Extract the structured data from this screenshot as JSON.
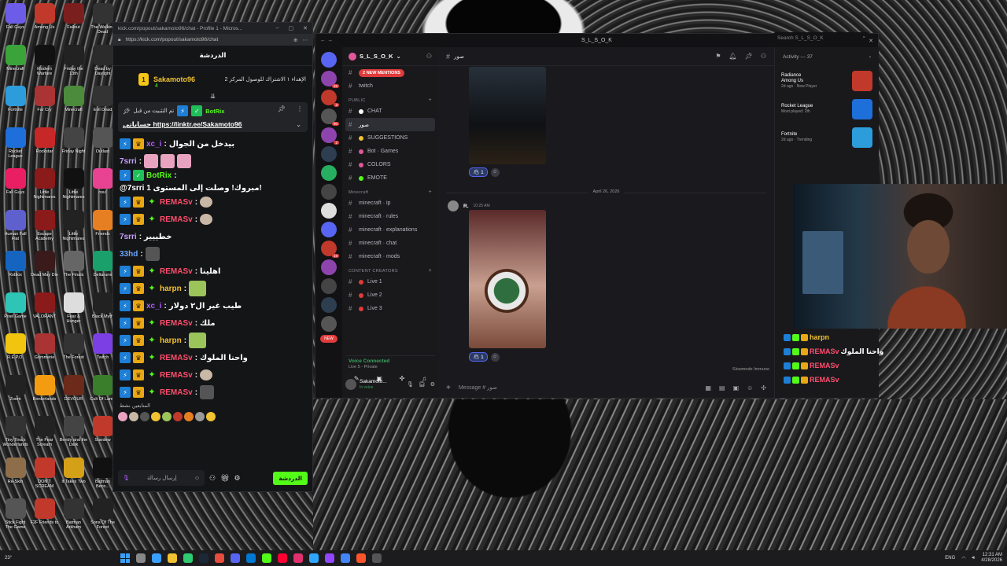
{
  "desktop": {
    "icons": [
      {
        "label": "Fall Guys",
        "icon": "fall-guys-icon",
        "color": "#6c5ce7"
      },
      {
        "label": "Among Us",
        "icon": "among-us-icon",
        "color": "#c0392b"
      },
      {
        "label": "Fallout",
        "icon": "fallout-icon",
        "color": "#7b1e1e"
      },
      {
        "label": "The Walking Dead",
        "icon": "walking-dead-icon",
        "color": "#333"
      },
      {
        "label": "Minecraft",
        "icon": "minecraft-icon",
        "color": "#3aa33a"
      },
      {
        "label": "Modern Warfare",
        "icon": "mw-icon",
        "color": "#111"
      },
      {
        "label": "Friday the 13th",
        "icon": "friday-icon",
        "color": "#222"
      },
      {
        "label": "Dead by Daylight",
        "icon": "dbd-icon",
        "color": "#2b2b2b"
      },
      {
        "label": "Fortnite",
        "icon": "fortnite-icon",
        "color": "#2d9cdb"
      },
      {
        "label": "Far Cry",
        "icon": "farcry-icon",
        "color": "#a33"
      },
      {
        "label": "Minecraft",
        "icon": "minecraft2-icon",
        "color": "#4b8b3b"
      },
      {
        "label": "Evil Dead",
        "icon": "evil-dead-icon",
        "color": "#333"
      },
      {
        "label": "Rocket League",
        "icon": "rocket-league-icon",
        "color": "#1e6fd9"
      },
      {
        "label": "Rockstar",
        "icon": "rockstar-icon",
        "color": "#c62828"
      },
      {
        "label": "Friday Night",
        "icon": "fnf-icon",
        "color": "#444"
      },
      {
        "label": "Outlast",
        "icon": "outlast-icon",
        "color": "#555"
      },
      {
        "label": "Fall Guys",
        "icon": "fallguys2-icon",
        "color": "#e91e63"
      },
      {
        "label": "Little Nightmares",
        "icon": "little-nightmares-icon",
        "color": "#8b1a1a"
      },
      {
        "label": "Little Nightmares",
        "icon": "little-nightmares2-icon",
        "color": "#111"
      },
      {
        "label": "osu!",
        "icon": "osu-icon",
        "color": "#e84393"
      },
      {
        "label": "Human Fall Flat",
        "icon": "human-icon",
        "color": "#5e60ce"
      },
      {
        "label": "Escape Academy",
        "icon": "escape-icon",
        "color": "#8b1a1a"
      },
      {
        "label": "Little Nightmares",
        "icon": "ln3-icon",
        "color": "#222"
      },
      {
        "label": "Friends",
        "icon": "friends-icon",
        "color": "#e67e22"
      },
      {
        "label": "Roblox",
        "icon": "roblox-icon",
        "color": "#1565c0"
      },
      {
        "label": "Dead May Die",
        "icon": "dead-may-die-icon",
        "color": "#3a1a1a"
      },
      {
        "label": "The Finals",
        "icon": "finals-icon",
        "color": "#666"
      },
      {
        "label": "Deltarune",
        "icon": "deltarune-icon",
        "color": "#1aa06b"
      },
      {
        "label": "Pixel Game",
        "icon": "pixel-icon",
        "color": "#2ec4b6"
      },
      {
        "label": "VALORANT",
        "icon": "valorant-icon",
        "color": "#8b1a1a"
      },
      {
        "label": "Fear & Hunger",
        "icon": "fear-icon",
        "color": "#ddd"
      },
      {
        "label": "Black Myth",
        "icon": "black-myth-icon",
        "color": "#222"
      },
      {
        "label": "R.E.P.O.",
        "icon": "repo-icon",
        "color": "#f1c40f"
      },
      {
        "label": "Grimmerie",
        "icon": "grim-icon",
        "color": "#a33"
      },
      {
        "label": "The Forest",
        "icon": "forest-icon",
        "color": "#333"
      },
      {
        "label": "Twitch",
        "icon": "twitch-icon",
        "color": "#7b3fe4"
      },
      {
        "label": "Zoom",
        "icon": "zoom-icon",
        "color": "#222"
      },
      {
        "label": "Borderlands",
        "icon": "borderlands-icon",
        "color": "#f39c12"
      },
      {
        "label": "DEVOUR",
        "icon": "devour-icon",
        "color": "#6b2a1a"
      },
      {
        "label": "Cult Of Lamb",
        "icon": "cult-icon",
        "color": "#3a7d2a"
      },
      {
        "label": "Tiny Tina's Wonderlands",
        "icon": "tiny-tina-icon",
        "color": "#333"
      },
      {
        "label": "The Fear Scream",
        "icon": "fear-scream-icon",
        "color": "#222"
      },
      {
        "label": "Bendy and the Dark",
        "icon": "bendy-icon",
        "color": "#444"
      },
      {
        "label": "Stardew",
        "icon": "stardew-icon",
        "color": "#c0392b"
      },
      {
        "label": "Re-Skin",
        "icon": "reskin-icon",
        "color": "#8e6e4a"
      },
      {
        "label": "DON'T SCREAM",
        "icon": "dont-scream-icon",
        "color": "#c0392b"
      },
      {
        "label": "It Takes Two",
        "icon": "it-takes-two-icon",
        "color": "#d4a017"
      },
      {
        "label": "Batman Beco...",
        "icon": "batman-icon",
        "color": "#111"
      },
      {
        "label": "Stick Fight The Game",
        "icon": "stick-fight-icon",
        "color": "#555"
      },
      {
        "label": "F2F Friends to",
        "icon": "f2f-icon",
        "color": "#c0392b"
      },
      {
        "label": "Batman Arkham",
        "icon": "batman2-icon",
        "color": "#333"
      },
      {
        "label": "Sons Of The Forest",
        "icon": "sons-icon",
        "color": "#222"
      }
    ]
  },
  "kick": {
    "window_title": "kick.com/popout/sakamoto96/chat - Profile 1 - Micros...",
    "url": "https://kick.com/popout/sakamoto96/chat",
    "chat_header": "الدردشة",
    "goal": {
      "name": "Sakamoto96",
      "rank": "1",
      "count": "4",
      "text": "الإهداء ١ الاشتراك للوصول المركز 2"
    },
    "pinned": {
      "by": "تم التثبيت من قبل",
      "name": "BotRix",
      "prefix": "حساباتي",
      "link": "https://linktr.ee/Sakamoto96"
    },
    "messages": [
      {
        "user": "xc_i",
        "color": "#b05cff",
        "text": "بيدخل من الجوال",
        "badges": [
          "b-blue",
          "b-gold"
        ]
      },
      {
        "user": "7srri",
        "color": "#c7a0ff",
        "text": "",
        "emotes": [
          "pink",
          "pink",
          "pink"
        ],
        "badges": []
      },
      {
        "user": "BotRix",
        "color": "#53fc18",
        "text": "@7srri مبروك! وصلت إلى المستوى 1!",
        "badges": [
          "b-blue",
          "b-green"
        ]
      },
      {
        "user": "REMASv",
        "color": "#ff4d6d",
        "text": "",
        "emotes": [
          "cat"
        ],
        "badges": [
          "b-blue",
          "b-gold",
          "b-spark"
        ]
      },
      {
        "user": "REMASv",
        "color": "#ff4d6d",
        "text": "",
        "emotes": [
          "cat"
        ],
        "badges": [
          "b-blue",
          "b-gold",
          "b-spark"
        ]
      },
      {
        "user": "7srri",
        "color": "#c7a0ff",
        "text": "خطييير",
        "badges": []
      },
      {
        "user": "33hd",
        "color": "#6aa7ff",
        "text": "",
        "emotes": [
          "dark"
        ],
        "badges": []
      },
      {
        "user": "REMASv",
        "color": "#ff4d6d",
        "text": "اهلينا",
        "badges": [
          "b-blue",
          "b-gold",
          "b-spark"
        ]
      },
      {
        "user": "harpn",
        "color": "#f1c232",
        "text": "",
        "emotes": [
          "green"
        ],
        "badges": [
          "b-blue",
          "b-gold",
          "b-spark"
        ]
      },
      {
        "user": "xc_i",
        "color": "#b05cff",
        "text": "طيب غير ال٢ دولار",
        "badges": [
          "b-blue",
          "b-gold"
        ]
      },
      {
        "user": "REMASv",
        "color": "#ff4d6d",
        "text": "ملك",
        "badges": [
          "b-blue",
          "b-gold",
          "b-spark"
        ]
      },
      {
        "user": "harpn",
        "color": "#f1c232",
        "text": "",
        "emotes": [
          "green"
        ],
        "badges": [
          "b-blue",
          "b-gold",
          "b-spark"
        ]
      },
      {
        "user": "REMASv",
        "color": "#ff4d6d",
        "text": "واحنا الملوك",
        "badges": [
          "b-blue",
          "b-gold",
          "b-spark"
        ]
      },
      {
        "user": "REMASv",
        "color": "#ff4d6d",
        "text": "",
        "emotes": [
          "cat"
        ],
        "badges": [
          "b-blue",
          "b-gold",
          "b-spark"
        ]
      },
      {
        "user": "REMASv",
        "color": "#ff4d6d",
        "text": "",
        "emotes": [
          "dark"
        ],
        "badges": [
          "b-blue",
          "b-gold",
          "b-spark"
        ]
      }
    ],
    "active_label": "المتابعين نشط",
    "input_placeholder": "إرسال رسالة",
    "send_label": "الدردشة"
  },
  "discord": {
    "window_title": "S_L_S_O_K",
    "guild_name": "S_L_S_O_K",
    "top_channels": [
      {
        "name": "2 NEW MENTIONS",
        "type": "mentions"
      },
      {
        "name": "twitch",
        "type": "text"
      }
    ],
    "categories": [
      {
        "name": "PUBLIC",
        "channels": [
          {
            "name": "CHAT",
            "dot": "#ffffff"
          },
          {
            "name": "صور",
            "active": true
          },
          {
            "name": "SUGGESTIONS",
            "dot": "#f1c232"
          },
          {
            "name": "Bot · Games",
            "dot": "#e0589b"
          },
          {
            "name": "COLORS",
            "dot": "#e0589b"
          },
          {
            "name": "EMOTE",
            "dot": "#53fc18"
          }
        ]
      },
      {
        "name": "Minecraft",
        "channels": [
          {
            "name": "minecraft · ip"
          },
          {
            "name": "minecraft · rules"
          },
          {
            "name": "minecraft · explanations"
          },
          {
            "name": "minecraft · chat"
          },
          {
            "name": "minecraft · mods"
          }
        ]
      },
      {
        "name": "CONTENT CREATORS",
        "channels": [
          {
            "name": "Live 1",
            "dot": "#e03b3b"
          },
          {
            "name": "Live 2",
            "dot": "#e03b3b"
          },
          {
            "name": "Live 3",
            "dot": "#e03b3b"
          }
        ]
      }
    ],
    "voice": {
      "status": "Voice Connected",
      "channel": "Live 5 - Private"
    },
    "user": {
      "name": "Sakamoto...",
      "status": "In voice"
    },
    "current_channel": "صور",
    "search_placeholder": "Search S_L_S_O_K",
    "date_divider": "April 26, 2026",
    "message_author": "R.",
    "message_time": "10:25 AM",
    "reaction_count": "1",
    "slowmode": "Slowmode Immune",
    "composer_placeholder": "Message # صور",
    "activity": {
      "header": "Activity — 37",
      "items": [
        {
          "user": "Radiance",
          "game": "Among Us",
          "sub": "2d ago · New Player",
          "color": "#c0392b"
        },
        {
          "user": "",
          "game": "Rocket League",
          "sub": "Most played: 2th",
          "color": "#1e6fd9"
        },
        {
          "user": "",
          "game": "Fortnite",
          "sub": "2d ago · Trending",
          "color": "#2d9cdb"
        }
      ]
    }
  },
  "overlay": {
    "rows": [
      {
        "user": "harpn",
        "color": "#f1c232",
        "text": ""
      },
      {
        "user": "REMASv",
        "color": "#ff4d6d",
        "text": "واحنا الملوك"
      },
      {
        "user": "REMASv",
        "color": "#ff4d6d",
        "text": ""
      },
      {
        "user": "REMASv",
        "color": "#ff4d6d",
        "text": ""
      }
    ]
  },
  "taskbar": {
    "weather": "23°",
    "lang": "ENG",
    "time": "12:31 AM",
    "date": "4/28/2026"
  }
}
